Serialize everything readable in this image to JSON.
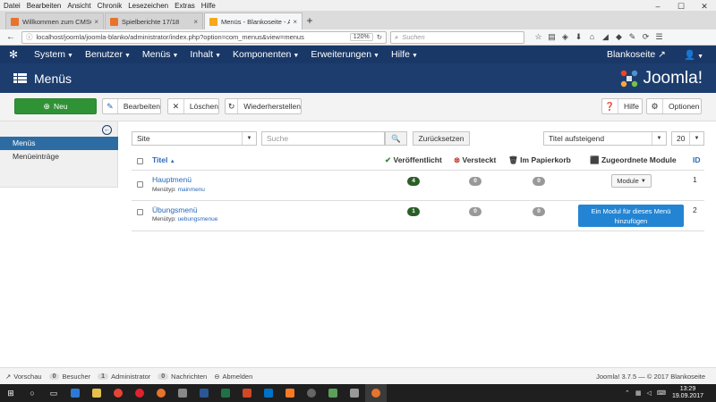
{
  "browser": {
    "menubar": [
      "Datei",
      "Bearbeiten",
      "Ansicht",
      "Chronik",
      "Lesezeichen",
      "Extras",
      "Hilfe"
    ],
    "window_controls": [
      "–",
      "☐",
      "✕"
    ],
    "tabs": [
      {
        "label": "Willkommen zum CMSOD",
        "favicon_color": "#e8732c"
      },
      {
        "label": "Spielberichte 17/18",
        "favicon_color": "#e8732c"
      },
      {
        "label": "Menüs - Blankoseite - Admi",
        "favicon_color": "#f4a81d"
      }
    ],
    "new_tab": "+",
    "tab_close": "×",
    "url": "localhost/joomla/joomla-blanko/administrator/index.php?option=com_menus&view=menus",
    "zoom": "120%",
    "search_placeholder": "Suchen"
  },
  "nav": {
    "items": [
      "System",
      "Benutzer",
      "Menüs",
      "Inhalt",
      "Komponenten",
      "Erweiterungen",
      "Hilfe"
    ],
    "site_link": "Blankoseite",
    "site_icon": "↗",
    "user_icon": "👤"
  },
  "header": {
    "title": "Menüs",
    "brand": "Joomla!"
  },
  "toolbar": {
    "new_label": "Neu",
    "edit_label": "Bearbeiten",
    "delete_label": "Löschen",
    "restore_label": "Wiederherstellen",
    "help_label": "Hilfe",
    "options_label": "Optionen"
  },
  "sidebar": {
    "items": [
      {
        "label": "Menüs",
        "active": true
      },
      {
        "label": "Menüeinträge",
        "active": false
      }
    ]
  },
  "filters": {
    "client_value": "Site",
    "search_placeholder": "Suche",
    "reset_label": "Zurücksetzen",
    "sort_value": "Titel aufsteigend",
    "limit_value": "20"
  },
  "table": {
    "headers": {
      "title": "Titel",
      "published": "Veröffentlicht",
      "unpublished": "Versteckt",
      "trashed": "Im Papierkorb",
      "modules": "Zugeordnete Module",
      "id": "ID"
    },
    "menutype_prefix": "Menütyp:",
    "rows": [
      {
        "title": "Hauptmenü",
        "menutype": "mainmenu",
        "published": "4",
        "unpublished": "0",
        "trashed": "0",
        "module_button": "Module",
        "id": "1"
      },
      {
        "title": "Übungsmenü",
        "menutype": "uebungsmenue",
        "published": "1",
        "unpublished": "0",
        "trashed": "0",
        "add_module_button": "Ein Modul für dieses Menü hinzufügen",
        "id": "2"
      }
    ]
  },
  "statusbar": {
    "preview": "Vorschau",
    "visitors_count": "0",
    "visitors": "Besucher",
    "admins_count": "1",
    "admins": "Administrator",
    "messages_count": "0",
    "messages": "Nachrichten",
    "logout": "Abmelden",
    "copyright": "Joomla! 3.7.5 — © 2017 Blankoseite"
  },
  "taskbar": {
    "time": "13:29",
    "date": "19.09.2017"
  },
  "colors": {
    "nav_bg": "#1a3867",
    "header_bg": "#1c3d6e",
    "new_button": "#2f9335",
    "published_badge": "#2a5e26",
    "add_module_button": "#2384d3",
    "sidebar_active": "#2d6ca2"
  }
}
